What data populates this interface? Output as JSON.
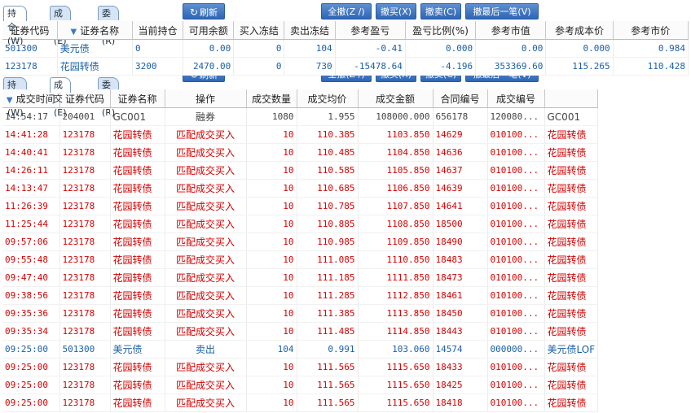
{
  "top": {
    "tabs": [
      "持仓(W)",
      "成交(E)",
      "委托(R)"
    ],
    "refresh_label": "刷新",
    "buttons": [
      "全撤(Z /)",
      "撤买(X)",
      "撤卖(C)",
      "撤最后一笔(V)"
    ],
    "columns": [
      "证券代码",
      "证券名称",
      "当前持仓",
      "可用余额",
      "买入冻结",
      "卖出冻结",
      "参考盈亏",
      "盈亏比例(%)",
      "参考市值",
      "参考成本价",
      "参考市价"
    ],
    "rows": [
      [
        "501300",
        "美元债",
        "0",
        "0.00",
        "0",
        "104",
        "-0.41",
        "0.000",
        "0.00",
        "0.000",
        "0.984"
      ],
      [
        "123178",
        "花园转债",
        "3200",
        "2470.00",
        "0",
        "730",
        "-15478.64",
        "-4.196",
        "353369.60",
        "115.265",
        "110.428"
      ]
    ]
  },
  "bottom": {
    "tabs": [
      "持仓(W)",
      "成交(E)",
      "委托(R)"
    ],
    "refresh_label": "刷新",
    "columns": [
      "成交时间",
      "证券代码",
      "证券名称",
      "操作",
      "成交数量",
      "成交均价",
      "成交金额",
      "合同编号",
      "成交编号",
      ""
    ],
    "rows": [
      {
        "style": "gray",
        "cells": [
          "14:54:17",
          "204001",
          "GC001",
          "融券",
          "1080",
          "1.955",
          "108000.000",
          "656178",
          "120080...",
          "GC001"
        ]
      },
      {
        "style": "red",
        "cells": [
          "14:41:28",
          "123178",
          "花园转债",
          "匹配成交买入",
          "10",
          "110.385",
          "1103.850",
          "14629",
          "010100...",
          "花园转债"
        ]
      },
      {
        "style": "red",
        "cells": [
          "14:40:41",
          "123178",
          "花园转债",
          "匹配成交买入",
          "10",
          "110.485",
          "1104.850",
          "14636",
          "010100...",
          "花园转债"
        ]
      },
      {
        "style": "red",
        "cells": [
          "14:26:11",
          "123178",
          "花园转债",
          "匹配成交买入",
          "10",
          "110.585",
          "1105.850",
          "14637",
          "010100...",
          "花园转债"
        ]
      },
      {
        "style": "red",
        "cells": [
          "14:13:47",
          "123178",
          "花园转债",
          "匹配成交买入",
          "10",
          "110.685",
          "1106.850",
          "14639",
          "010100...",
          "花园转债"
        ]
      },
      {
        "style": "red",
        "cells": [
          "11:26:39",
          "123178",
          "花园转债",
          "匹配成交买入",
          "10",
          "110.785",
          "1107.850",
          "14641",
          "010100...",
          "花园转债"
        ]
      },
      {
        "style": "red",
        "cells": [
          "11:25:44",
          "123178",
          "花园转债",
          "匹配成交买入",
          "10",
          "110.885",
          "1108.850",
          "18500",
          "010100...",
          "花园转债"
        ]
      },
      {
        "style": "red",
        "cells": [
          "09:57:06",
          "123178",
          "花园转债",
          "匹配成交买入",
          "10",
          "110.985",
          "1109.850",
          "18490",
          "010100...",
          "花园转债"
        ]
      },
      {
        "style": "red",
        "cells": [
          "09:55:48",
          "123178",
          "花园转债",
          "匹配成交买入",
          "10",
          "111.085",
          "1110.850",
          "18483",
          "010100...",
          "花园转债"
        ]
      },
      {
        "style": "red",
        "cells": [
          "09:47:40",
          "123178",
          "花园转债",
          "匹配成交买入",
          "10",
          "111.185",
          "1111.850",
          "18473",
          "010100...",
          "花园转债"
        ]
      },
      {
        "style": "red",
        "cells": [
          "09:38:56",
          "123178",
          "花园转债",
          "匹配成交买入",
          "10",
          "111.285",
          "1112.850",
          "18461",
          "010100...",
          "花园转债"
        ]
      },
      {
        "style": "red",
        "cells": [
          "09:35:36",
          "123178",
          "花园转债",
          "匹配成交买入",
          "10",
          "111.385",
          "1113.850",
          "18450",
          "010100...",
          "花园转债"
        ]
      },
      {
        "style": "red",
        "cells": [
          "09:35:34",
          "123178",
          "花园转债",
          "匹配成交买入",
          "10",
          "111.485",
          "1114.850",
          "18443",
          "010100...",
          "花园转债"
        ]
      },
      {
        "style": "blue",
        "cells": [
          "09:25:00",
          "501300",
          "美元债",
          "卖出",
          "104",
          "0.991",
          "103.060",
          "14574",
          "000000...",
          "美元债LOF"
        ]
      },
      {
        "style": "red",
        "cells": [
          "09:25:00",
          "123178",
          "花园转债",
          "匹配成交买入",
          "10",
          "111.565",
          "1115.650",
          "18433",
          "010100...",
          "花园转债"
        ]
      },
      {
        "style": "red",
        "cells": [
          "09:25:00",
          "123178",
          "花园转债",
          "匹配成交买入",
          "10",
          "111.565",
          "1115.650",
          "18425",
          "010100...",
          "花园转债"
        ]
      },
      {
        "style": "red",
        "cells": [
          "09:25:00",
          "123178",
          "花园转债",
          "匹配成交买入",
          "10",
          "111.565",
          "1115.650",
          "18418",
          "010100...",
          "花园转债"
        ]
      }
    ]
  },
  "colors": {
    "buy_red": "#d40000",
    "sell_blue": "#1a5fa8",
    "button_blue": "#2d66b5"
  }
}
